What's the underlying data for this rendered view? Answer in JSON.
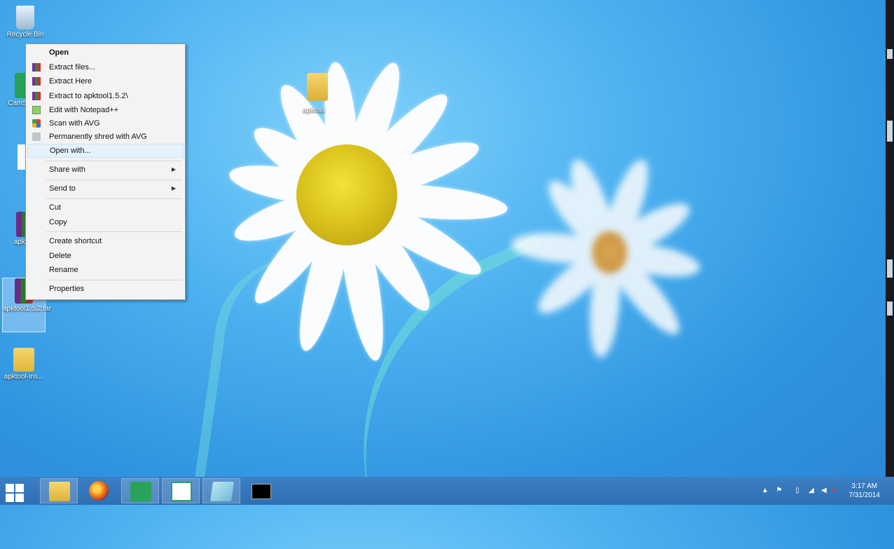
{
  "desktop": {
    "icons": [
      {
        "label": "Recycle Bin"
      },
      {
        "label": "CamStudio"
      },
      {
        "label": ""
      },
      {
        "label": "apktool"
      },
      {
        "label": "apktool1.5.2.tar"
      },
      {
        "label": "apktool-ins..."
      }
    ],
    "floating_folder_label": "apktool"
  },
  "context_menu": {
    "items": [
      {
        "label": "Open"
      },
      {
        "label": "Extract files..."
      },
      {
        "label": "Extract Here"
      },
      {
        "label": "Extract to apktool1.5.2\\"
      },
      {
        "label": "Edit with Notepad++"
      },
      {
        "label": "Scan with AVG"
      },
      {
        "label": "Permanently shred with AVG"
      },
      {
        "label": "Open with..."
      },
      {
        "label": "Share with"
      },
      {
        "label": "Send to"
      },
      {
        "label": "Cut"
      },
      {
        "label": "Copy"
      },
      {
        "label": "Create shortcut"
      },
      {
        "label": "Delete"
      },
      {
        "label": "Rename"
      },
      {
        "label": "Properties"
      }
    ],
    "submenu_arrow": "▶"
  },
  "taskbar": {
    "tray_arrow": "▲",
    "clock_time": "3:17 AM",
    "clock_date": "7/31/2014"
  }
}
